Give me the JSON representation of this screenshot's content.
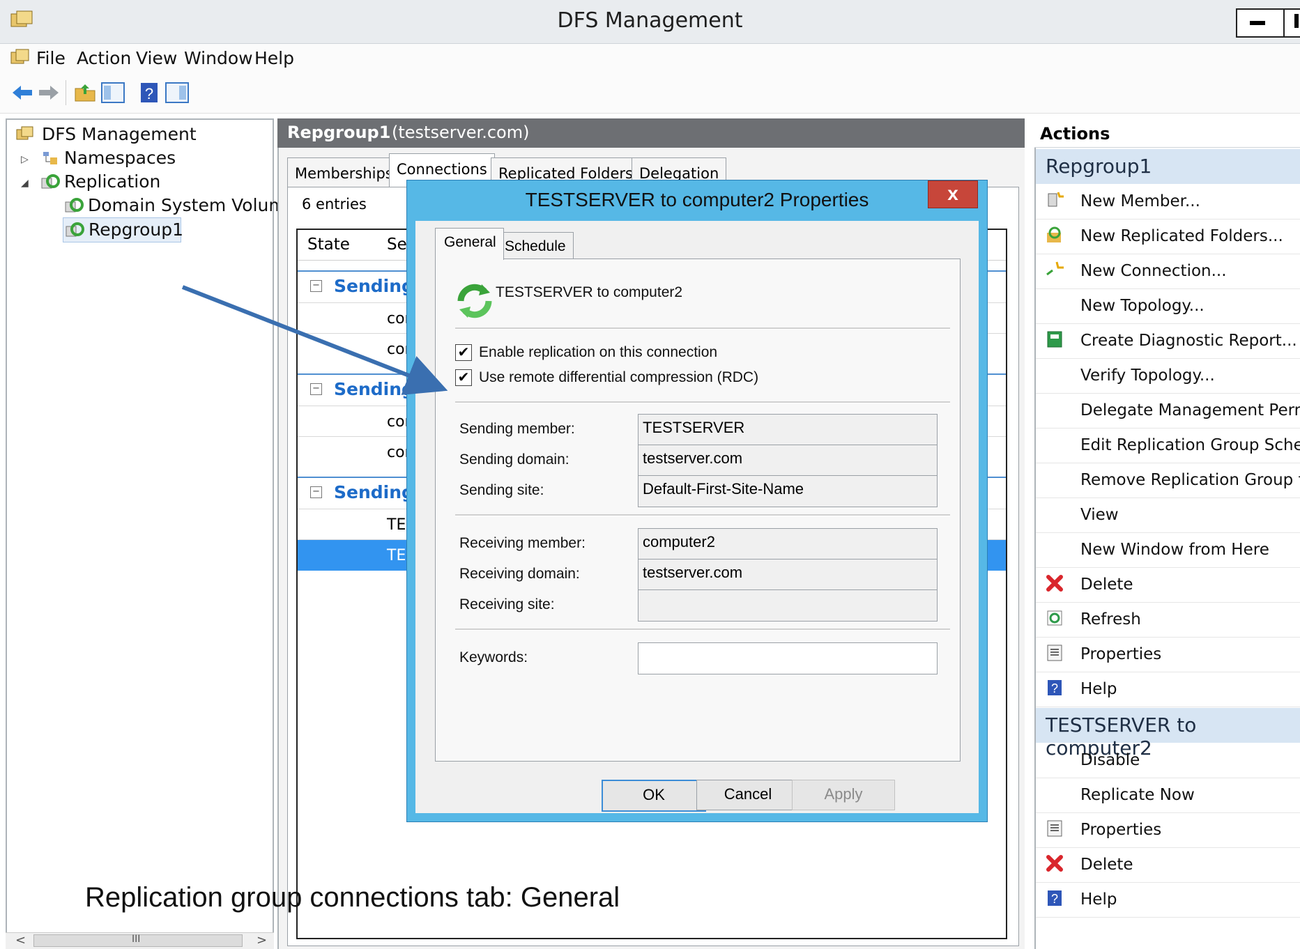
{
  "window": {
    "title": "DFS Management"
  },
  "menu": [
    "File",
    "Action",
    "View",
    "Window",
    "Help"
  ],
  "tree": {
    "root": "DFS Management",
    "namespaces": "Namespaces",
    "replication": "Replication",
    "domain_system_volume": "Domain System Volume",
    "repgroup": "Repgroup1"
  },
  "tree_hscroll": {
    "thumb_glyph": "III"
  },
  "center": {
    "header_title": "Repgroup1",
    "header_domain": "(testserver.com)",
    "tabs": [
      "Memberships",
      "Connections",
      "Replicated Folders",
      "Delegation"
    ],
    "entries": "6 entries",
    "columns": [
      "State",
      "Se"
    ],
    "groups": [
      {
        "label": "Sending I",
        "rows": [
          "cor",
          "cor"
        ]
      },
      {
        "label": "Sending I",
        "rows": [
          "cor",
          "cor"
        ]
      },
      {
        "label": "Sending I",
        "rows": [
          "TE",
          "TE"
        ]
      }
    ]
  },
  "actions": {
    "title": "Actions",
    "section1": "Repgroup1",
    "items1": [
      {
        "label": "New Member...",
        "icon": "new-member-icon"
      },
      {
        "label": "New Replicated Folders...",
        "icon": "new-replicated-folders-icon"
      },
      {
        "label": "New Connection...",
        "icon": "new-connection-icon"
      },
      {
        "label": "New Topology...",
        "icon": ""
      },
      {
        "label": "Create Diagnostic Report...",
        "icon": "report-icon"
      },
      {
        "label": "Verify Topology...",
        "icon": ""
      },
      {
        "label": "Delegate Management Permis",
        "icon": ""
      },
      {
        "label": "Edit Replication Group Schedu",
        "icon": ""
      },
      {
        "label": "Remove Replication Group fro",
        "icon": ""
      },
      {
        "label": "View",
        "icon": ""
      },
      {
        "label": "New Window from Here",
        "icon": ""
      },
      {
        "label": "Delete",
        "icon": "delete-icon"
      },
      {
        "label": "Refresh",
        "icon": "refresh-icon"
      },
      {
        "label": "Properties",
        "icon": "properties-icon"
      },
      {
        "label": "Help",
        "icon": "help-icon"
      }
    ],
    "section2": "TESTSERVER to computer2",
    "items2": [
      {
        "label": "Disable",
        "icon": ""
      },
      {
        "label": "Replicate Now",
        "icon": ""
      },
      {
        "label": "Properties",
        "icon": "properties-icon"
      },
      {
        "label": "Delete",
        "icon": "delete-icon"
      },
      {
        "label": "Help",
        "icon": "help-icon"
      }
    ]
  },
  "dialog": {
    "title": "TESTSERVER to computer2 Properties",
    "close_label": "x",
    "tabs": [
      "General",
      "Schedule"
    ],
    "connection_name": "TESTSERVER to computer2",
    "checkboxes": [
      {
        "label": "Enable replication on this connection",
        "checked": true
      },
      {
        "label": "Use remote differential compression (RDC)",
        "checked": true
      }
    ],
    "fields": {
      "sending_member_label": "Sending member:",
      "sending_member": "TESTSERVER",
      "sending_domain_label": "Sending domain:",
      "sending_domain": "testserver.com",
      "sending_site_label": "Sending site:",
      "sending_site": "Default-First-Site-Name",
      "receiving_member_label": "Receiving member:",
      "receiving_member": "computer2",
      "receiving_domain_label": "Receiving domain:",
      "receiving_domain": "testserver.com",
      "receiving_site_label": "Receiving site:",
      "receiving_site": "",
      "keywords_label": "Keywords:",
      "keywords": ""
    },
    "buttons": {
      "ok": "OK",
      "cancel": "Cancel",
      "apply": "Apply"
    }
  },
  "caption": "Replication group connections tab: General",
  "colors": {
    "accent": "#3294f0",
    "dialog_frame": "#56b8e6",
    "close": "#c7463a",
    "group_text": "#1d6bc8"
  }
}
